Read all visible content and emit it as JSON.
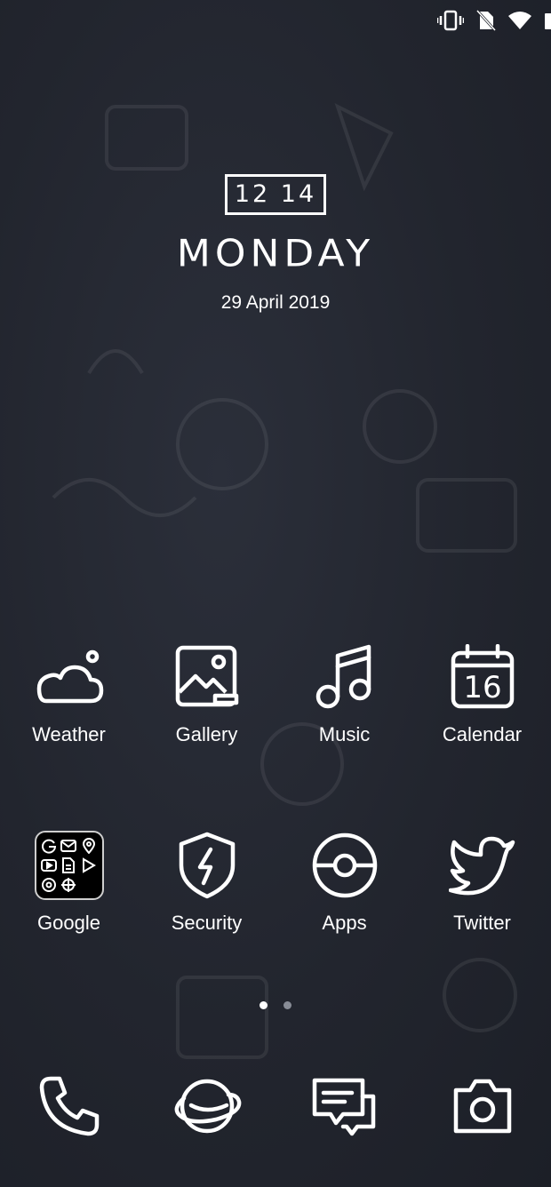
{
  "clock": {
    "time": "12 14",
    "day": "MONDAY",
    "date": "29 April 2019"
  },
  "apps_row1": [
    {
      "label": "Weather",
      "icon": "weather-icon"
    },
    {
      "label": "Gallery",
      "icon": "gallery-icon"
    },
    {
      "label": "Music",
      "icon": "music-icon"
    },
    {
      "label": "Calendar",
      "icon": "calendar-icon",
      "badge": "16"
    }
  ],
  "apps_row2": [
    {
      "label": "Google",
      "icon": "google-folder-icon"
    },
    {
      "label": "Security",
      "icon": "security-icon"
    },
    {
      "label": "Apps",
      "icon": "apps-icon"
    },
    {
      "label": "Twitter",
      "icon": "twitter-icon"
    }
  ],
  "dock": [
    {
      "icon": "phone-icon"
    },
    {
      "icon": "browser-icon"
    },
    {
      "icon": "messages-icon"
    },
    {
      "icon": "camera-icon"
    }
  ],
  "pages": {
    "count": 2,
    "active": 1
  },
  "status": {
    "icons": [
      "vibrate-icon",
      "no-sim-icon",
      "wifi-icon",
      "battery-icon"
    ]
  }
}
